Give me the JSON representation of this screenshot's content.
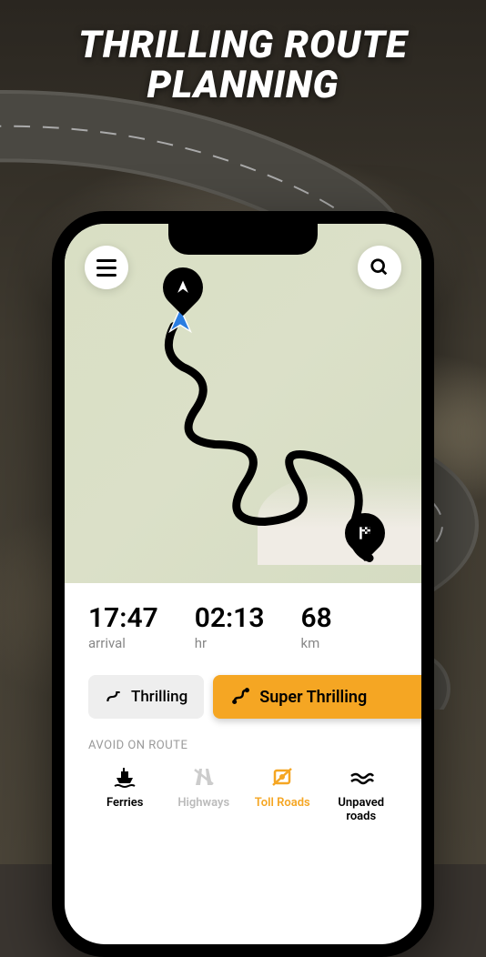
{
  "headline": {
    "line1": "THRILLING ROUTE",
    "line2": "PLANNING"
  },
  "stats": {
    "arrival": {
      "value": "17:47",
      "label": "arrival"
    },
    "duration": {
      "value": "02:13",
      "label": "hr"
    },
    "distance": {
      "value": "68",
      "label": "km"
    }
  },
  "modes": {
    "thrilling": "Thrilling",
    "super": "Super Thrilling"
  },
  "avoid": {
    "title": "AVOID ON ROUTE",
    "items": [
      {
        "label": "Ferries"
      },
      {
        "label": "Highways"
      },
      {
        "label": "Toll Roads"
      },
      {
        "label": "Unpaved\nroads"
      }
    ]
  },
  "colors": {
    "accent": "#f5a623",
    "map_bg": "#d9dfc4"
  }
}
